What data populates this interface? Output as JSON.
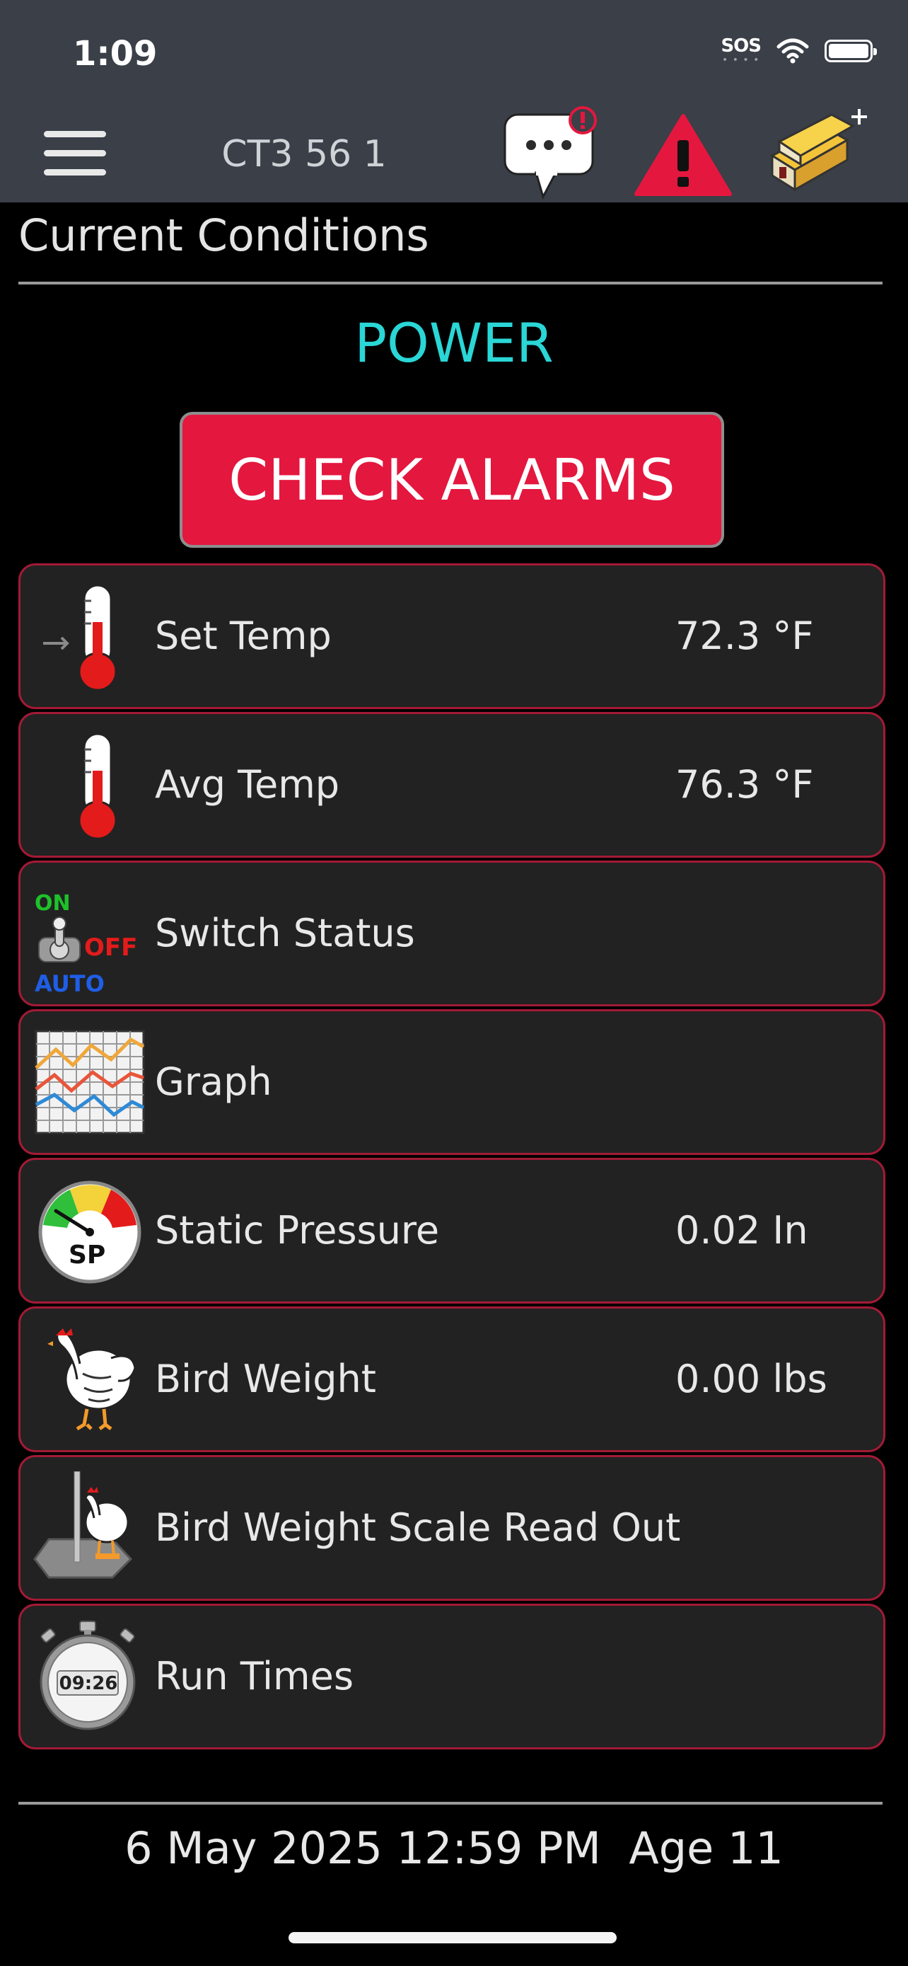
{
  "status_bar": {
    "time": "1:09",
    "sos": "SOS"
  },
  "header": {
    "title": "CT3 56 1"
  },
  "section": {
    "title": "Current Conditions"
  },
  "system": {
    "mode": "POWER",
    "check_alarms_label": "CHECK ALARMS"
  },
  "rows": [
    {
      "label": "Set Temp",
      "value": "72.3 °F",
      "icon": "thermometer-set-icon"
    },
    {
      "label": "Avg Temp",
      "value": "76.3 °F",
      "icon": "thermometer-icon"
    },
    {
      "label": "Switch Status",
      "value": "",
      "icon": "toggle-switch-icon",
      "switch_labels": {
        "on": "ON",
        "off": "OFF",
        "auto": "AUTO"
      }
    },
    {
      "label": "Graph",
      "value": "",
      "icon": "graph-icon"
    },
    {
      "label": "Static Pressure",
      "value": "0.02 In",
      "icon": "pressure-gauge-icon",
      "gauge_text": "SP"
    },
    {
      "label": "Bird Weight",
      "value": "0.00 lbs",
      "icon": "chicken-icon"
    },
    {
      "label": "Bird Weight Scale Read Out",
      "value": "",
      "icon": "bird-scale-icon"
    },
    {
      "label": "Run Times",
      "value": "",
      "icon": "stopwatch-icon",
      "stopwatch_text": "09:26"
    }
  ],
  "footer": {
    "date_time": "6 May 2025 12:59 PM",
    "age": "Age 11"
  },
  "colors": {
    "accent_power": "#2ad6d6",
    "alarm_red": "#e4173e",
    "row_border": "#a31a36",
    "topbar": "#3a3f48"
  }
}
